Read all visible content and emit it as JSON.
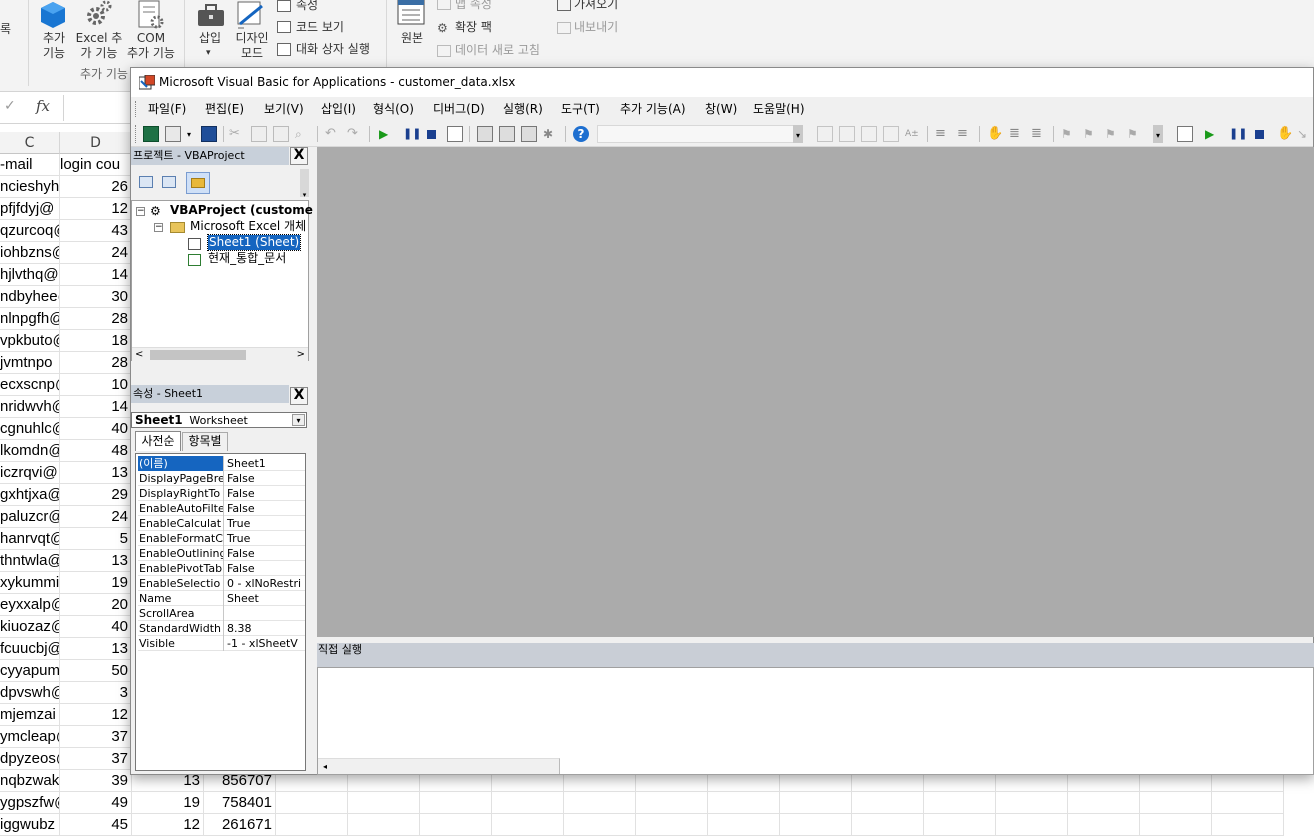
{
  "ribbon": {
    "left_cut": "록",
    "addins": "추가\n기능",
    "excel_addins": "Excel 추\n가 기능",
    "com_addins": "COM\n추가 기능",
    "group_label": "추가 기능",
    "insert": "삽입",
    "design_mode": "디자인\n모드",
    "properties": "속성",
    "view_code": "코드 보기",
    "run_dialog": "대화 상자 실행",
    "source": "원본",
    "map_props": "맵 속성",
    "expansion": "확장 팩",
    "refresh": "데이터 새로 고침",
    "import": "가져오기",
    "export": "내보내기"
  },
  "formula_bar": {
    "fx": "fx"
  },
  "grid": {
    "columns": [
      "C",
      "D"
    ],
    "header_row": {
      "c": "-mail",
      "d": "login cou"
    },
    "rows": [
      {
        "c": "ncieshyh@",
        "d": "26"
      },
      {
        "c": "pfjfdyj@",
        "d": "12"
      },
      {
        "c": "qzurcoq@",
        "d": "43"
      },
      {
        "c": "iohbzns@",
        "d": "24"
      },
      {
        "c": "hjlvthq@",
        "d": "14"
      },
      {
        "c": "ndbyhee@",
        "d": "30"
      },
      {
        "c": "nlnpgfh@",
        "d": "28"
      },
      {
        "c": "vpkbuto@",
        "d": "18"
      },
      {
        "c": "jvmtnpo",
        "d": "28"
      },
      {
        "c": "ecxscnp@",
        "d": "10"
      },
      {
        "c": "nridwvh@",
        "d": "14"
      },
      {
        "c": "cgnuhlc@",
        "d": "40"
      },
      {
        "c": "lkomdn@",
        "d": "48"
      },
      {
        "c": "iczrqvi@",
        "d": "13"
      },
      {
        "c": "gxhtjxa@",
        "d": "29"
      },
      {
        "c": "paluzcr@",
        "d": "24"
      },
      {
        "c": "hanrvqt@",
        "d": "5"
      },
      {
        "c": "thntwla@",
        "d": "13"
      },
      {
        "c": "xykummi",
        "d": "19"
      },
      {
        "c": "eyxxalp@",
        "d": "20"
      },
      {
        "c": "kiuozaz@",
        "d": "40"
      },
      {
        "c": "fcuucbj@",
        "d": "13"
      },
      {
        "c": "cyyapum",
        "d": "50"
      },
      {
        "c": "dpvswh@",
        "d": "3"
      },
      {
        "c": "mjemzai",
        "d": "12"
      },
      {
        "c": "ymcleap@",
        "d": "37"
      },
      {
        "c": "dpyzeos@",
        "d": "37"
      },
      {
        "c": "nqbzwak",
        "d": "39",
        "e": "13",
        "f": "856707"
      },
      {
        "c": "ygpszfw@",
        "d": "49",
        "e": "19",
        "f": "758401"
      },
      {
        "c": "iggwubz",
        "d": "45",
        "e": "12",
        "f": "261671"
      }
    ]
  },
  "vba": {
    "title": "Microsoft Visual Basic for Applications - customer_data.xlsx",
    "menu": [
      "파일(F)",
      "편집(E)",
      "보기(V)",
      "삽입(I)",
      "형식(O)",
      "디버그(D)",
      "실행(R)",
      "도구(T)",
      "추가 기능(A)",
      "창(W)",
      "도움말(H)"
    ],
    "project": {
      "header": "프로젝트 - VBAProject",
      "close": "X",
      "root": "VBAProject (custome",
      "folder": "Microsoft Excel 개체",
      "sheet": "Sheet1 (Sheet)",
      "workbook": "현재_통합_문서"
    },
    "properties": {
      "header": "속성 - Sheet1",
      "close": "X",
      "object_name": "Sheet1",
      "object_type": "Worksheet",
      "tab_alpha": "사전순",
      "tab_cat": "항목별",
      "rows": [
        {
          "name": "(이름)",
          "value": "Sheet1"
        },
        {
          "name": "DisplayPageBre",
          "value": "False"
        },
        {
          "name": "DisplayRightTo",
          "value": "False"
        },
        {
          "name": "EnableAutoFilte",
          "value": "False"
        },
        {
          "name": "EnableCalculat",
          "value": "True"
        },
        {
          "name": "EnableFormatC",
          "value": "True"
        },
        {
          "name": "EnableOutlining",
          "value": "False"
        },
        {
          "name": "EnablePivotTab",
          "value": "False"
        },
        {
          "name": "EnableSelectio",
          "value": "0 - xlNoRestri"
        },
        {
          "name": "Name",
          "value": "Sheet"
        },
        {
          "name": "ScrollArea",
          "value": ""
        },
        {
          "name": "StandardWidth",
          "value": "8.38"
        },
        {
          "name": "Visible",
          "value": "-1 - xlSheetV"
        }
      ]
    },
    "immediate": {
      "header": "직접 실행"
    }
  }
}
